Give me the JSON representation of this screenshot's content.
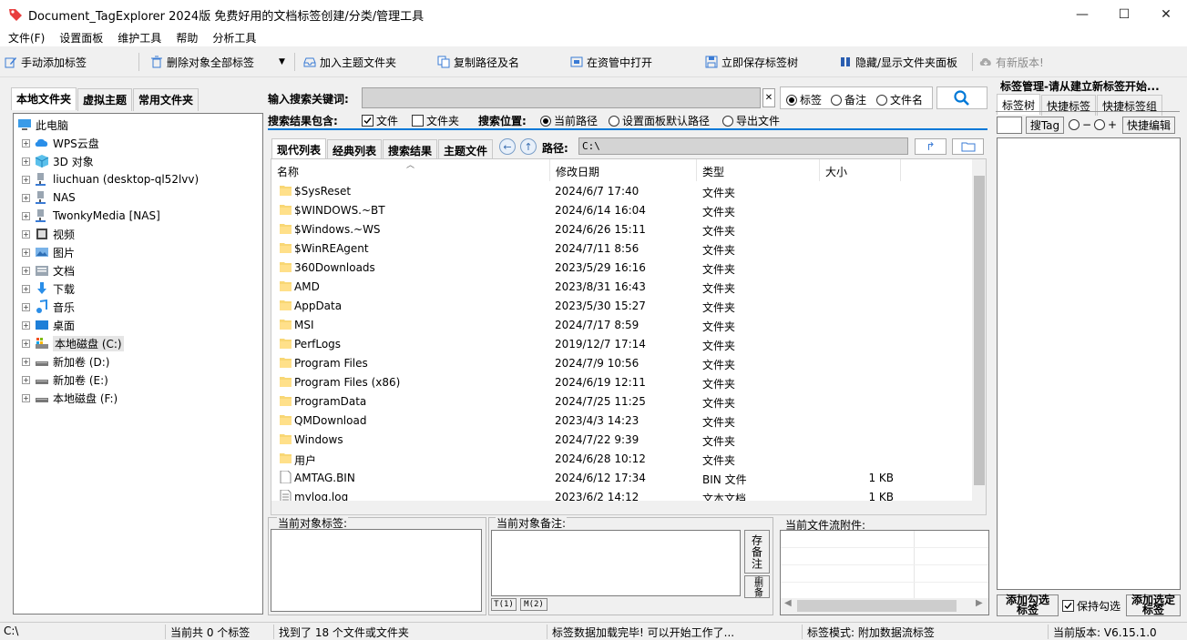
{
  "window": {
    "title": "Document_TagExplorer 2024版  免费好用的文档标签创建/分类/管理工具",
    "controls": {
      "minimize": "—",
      "maximize": "☐",
      "close": "✕"
    }
  },
  "menu": [
    "文件(F)",
    "设置面板",
    "维护工具",
    "帮助",
    "分析工具"
  ],
  "toolbar": {
    "manual_add": "手动添加标签",
    "delete_all": "删除对象全部标签",
    "add_theme": "加入主题文件夹",
    "copy_path": "复制路径及名",
    "open_explorer": "在资管中打开",
    "save_tree": "立即保存标签树",
    "toggle_panel": "隐藏/显示文件夹面板",
    "new_version": "有新版本!"
  },
  "left_tabs": [
    "本地文件夹",
    "虚拟主题",
    "常用文件夹"
  ],
  "tree": {
    "root": "此电脑",
    "items": [
      {
        "label": "WPS云盘",
        "icon": "cloud-icon"
      },
      {
        "label": "3D 对象",
        "icon": "cube-icon"
      },
      {
        "label": "liuchuan (desktop-ql52lvv)",
        "icon": "network-drive-icon"
      },
      {
        "label": "NAS",
        "icon": "network-drive-icon"
      },
      {
        "label": "TwonkyMedia [NAS]",
        "icon": "network-drive-icon"
      },
      {
        "label": "视频",
        "icon": "video-icon"
      },
      {
        "label": "图片",
        "icon": "picture-icon"
      },
      {
        "label": "文档",
        "icon": "document-icon"
      },
      {
        "label": "下载",
        "icon": "download-icon"
      },
      {
        "label": "音乐",
        "icon": "music-icon"
      },
      {
        "label": "桌面",
        "icon": "desktop-icon"
      },
      {
        "label": "本地磁盘 (C:)",
        "icon": "system-drive-icon",
        "selected": true
      },
      {
        "label": "新加卷 (D:)",
        "icon": "drive-icon"
      },
      {
        "label": "新加卷 (E:)",
        "icon": "drive-icon"
      },
      {
        "label": "本地磁盘 (F:)",
        "icon": "drive-icon"
      }
    ]
  },
  "search": {
    "keyword_label": "输入搜索关键词:",
    "keyword_value": "",
    "clear": "✕",
    "scope_options": [
      "标签",
      "备注",
      "文件名"
    ],
    "scope_selected": 0,
    "include_label": "搜索结果包含:",
    "include_file": "文件",
    "include_folder": "文件夹",
    "location_label": "搜索位置:",
    "location_options": [
      "当前路径",
      "设置面板默认路径",
      "导出文件"
    ],
    "location_selected": 0
  },
  "list_tabs": [
    "现代列表",
    "经典列表",
    "搜索结果",
    "主题文件"
  ],
  "path": {
    "label": "路径:",
    "value": "C:\\"
  },
  "columns": [
    "名称",
    "修改日期",
    "类型",
    "大小"
  ],
  "files": [
    {
      "name": "$SysReset",
      "date": "2024/6/7 17:40",
      "type": "文件夹",
      "size": "",
      "kind": "folder"
    },
    {
      "name": "$WINDOWS.~BT",
      "date": "2024/6/14 16:04",
      "type": "文件夹",
      "size": "",
      "kind": "folder"
    },
    {
      "name": "$Windows.~WS",
      "date": "2024/6/26 15:11",
      "type": "文件夹",
      "size": "",
      "kind": "folder"
    },
    {
      "name": "$WinREAgent",
      "date": "2024/7/11 8:56",
      "type": "文件夹",
      "size": "",
      "kind": "folder"
    },
    {
      "name": "360Downloads",
      "date": "2023/5/29 16:16",
      "type": "文件夹",
      "size": "",
      "kind": "folder"
    },
    {
      "name": "AMD",
      "date": "2023/8/31 16:43",
      "type": "文件夹",
      "size": "",
      "kind": "folder"
    },
    {
      "name": "AppData",
      "date": "2023/5/30 15:27",
      "type": "文件夹",
      "size": "",
      "kind": "folder"
    },
    {
      "name": "MSI",
      "date": "2024/7/17 8:59",
      "type": "文件夹",
      "size": "",
      "kind": "folder"
    },
    {
      "name": "PerfLogs",
      "date": "2019/12/7 17:14",
      "type": "文件夹",
      "size": "",
      "kind": "folder"
    },
    {
      "name": "Program Files",
      "date": "2024/7/9 10:56",
      "type": "文件夹",
      "size": "",
      "kind": "folder"
    },
    {
      "name": "Program Files (x86)",
      "date": "2024/6/19 12:11",
      "type": "文件夹",
      "size": "",
      "kind": "folder"
    },
    {
      "name": "ProgramData",
      "date": "2024/7/25 11:25",
      "type": "文件夹",
      "size": "",
      "kind": "folder"
    },
    {
      "name": "QMDownload",
      "date": "2023/4/3 14:23",
      "type": "文件夹",
      "size": "",
      "kind": "folder"
    },
    {
      "name": "Windows",
      "date": "2024/7/22 9:39",
      "type": "文件夹",
      "size": "",
      "kind": "folder"
    },
    {
      "name": "用户",
      "date": "2024/6/28 10:12",
      "type": "文件夹",
      "size": "",
      "kind": "folder"
    },
    {
      "name": "AMTAG.BIN",
      "date": "2024/6/12 17:34",
      "type": "BIN 文件",
      "size": "1 KB",
      "kind": "file"
    },
    {
      "name": "mylog.log",
      "date": "2023/6/2 14:12",
      "type": "文本文档",
      "size": "1 KB",
      "kind": "file"
    }
  ],
  "panes": {
    "tags_label": "当前对象标签:",
    "note_label": "当前对象备注:",
    "save_note": "存备注",
    "delete_note": "全删备注",
    "t_button": "T(1)",
    "m_button": "M(2)",
    "attach_label": "当前文件流附件:"
  },
  "right": {
    "title": "标签管理-请从建立新标签开始...",
    "tabs": [
      "标签树",
      "快捷标签",
      "快捷标签组"
    ],
    "search_tag": "搜Tag",
    "minus": "−",
    "plus": "+",
    "quick_edit": "快捷编辑",
    "add_checked": "添加勾选标签",
    "keep_checked": "保持勾选",
    "add_selected": "添加选定标签"
  },
  "status": {
    "path": "C:\\",
    "tag_count": "当前共 0 个标签",
    "found": "找到了 18 个文件或文件夹",
    "loaded": "标签数据加载完毕! 可以开始工作了...",
    "mode": "标签模式: 附加数据流标签",
    "version": "当前版本: V6.15.1.0"
  },
  "colors": {
    "accent": "#0078d7",
    "folder": "#f8d775",
    "app_icon": "#e83e3e"
  }
}
